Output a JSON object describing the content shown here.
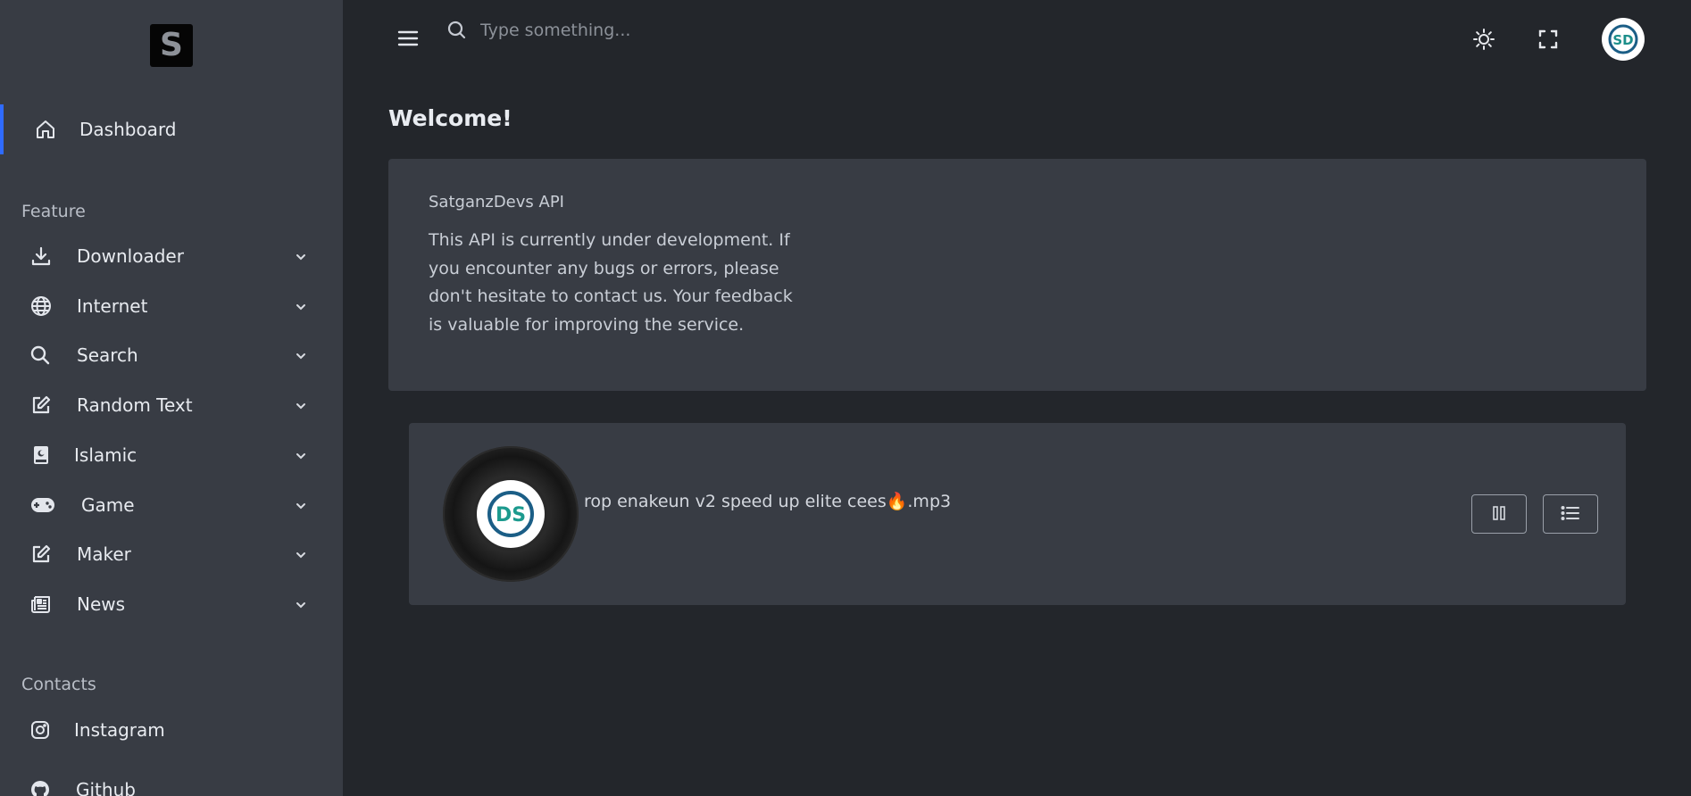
{
  "sidebar": {
    "logo_letter": "S",
    "dashboard": {
      "label": "Dashboard",
      "icon": "home-icon"
    },
    "feature_title": "Feature",
    "items": [
      {
        "label": "Downloader",
        "icon": "download-icon"
      },
      {
        "label": "Internet",
        "icon": "globe-icon"
      },
      {
        "label": "Search",
        "icon": "search-icon"
      },
      {
        "label": "Random Text",
        "icon": "edit-icon"
      },
      {
        "label": "Islamic",
        "icon": "quran-book-icon"
      },
      {
        "label": "Game",
        "icon": "gamepad-icon"
      },
      {
        "label": "Maker",
        "icon": "edit-icon"
      },
      {
        "label": "News",
        "icon": "newspaper-icon"
      }
    ],
    "contacts_title": "Contacts",
    "contacts": [
      {
        "label": "Instagram",
        "icon": "instagram-icon"
      },
      {
        "label": "Github",
        "icon": "github-icon"
      }
    ]
  },
  "topbar": {
    "search_placeholder": "Type something...",
    "avatar_text": "SD"
  },
  "main": {
    "title": "Welcome!",
    "card": {
      "title": "SatganzDevs API",
      "body": "This API is currently under development. If you encounter any bugs or errors, please don't hesitate to contact us. Your feedback is valuable for improving the service."
    },
    "player": {
      "track_name": "rop enakeun v2 speed up elite cees🔥.mp3",
      "disc_label_text": "DS"
    }
  },
  "colors": {
    "accent": "#2f6bff",
    "sidebar_bg": "#383c44",
    "page_bg": "#23262b",
    "card_bg": "#383c44"
  }
}
